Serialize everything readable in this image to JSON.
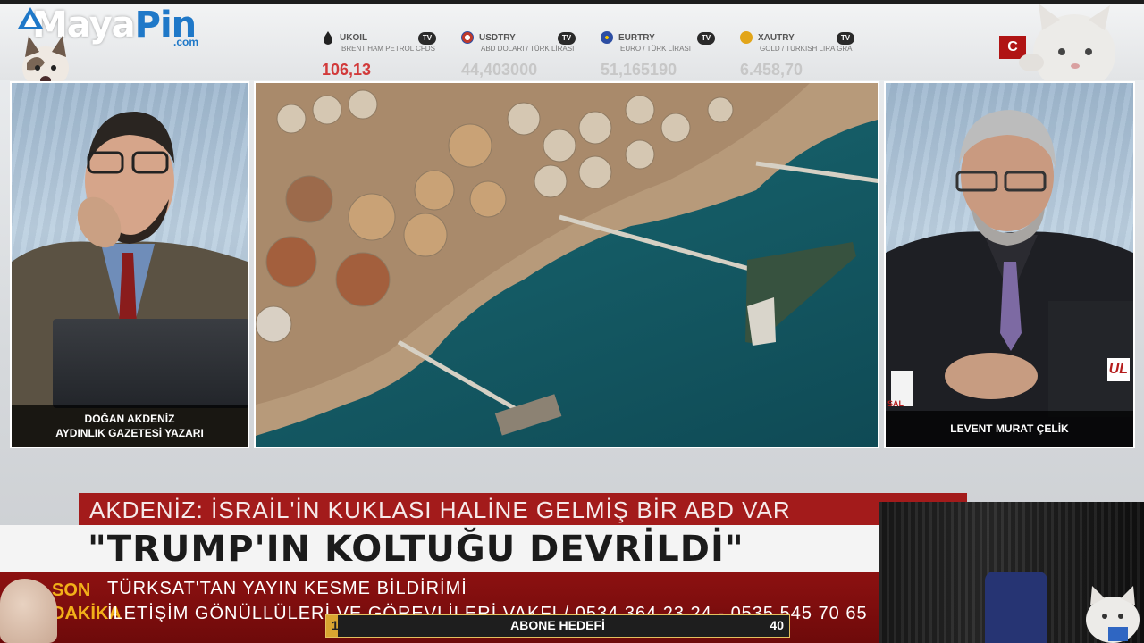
{
  "logo": {
    "maya": "Maya",
    "pin": "Pin",
    "com": ".com"
  },
  "tickers": [
    {
      "code": "UKOIL",
      "desc": "BRENT HAM PETROL CFDS",
      "value": "106,13",
      "color": "#222222",
      "value_color": "#d23a3a"
    },
    {
      "code": "USDTRY",
      "desc": "ABD DOLARI / TÜRK LİRASI",
      "value": "44,403000",
      "color": "#c0392b",
      "value_color": "#c7c7c7"
    },
    {
      "code": "EURTRY",
      "desc": "EURO / TÜRK LİRASI",
      "value": "51,165190",
      "color": "#2d4ea3",
      "value_color": "#c7c7c7"
    },
    {
      "code": "XAUTRY",
      "desc": "GOLD / TURKISH LIRA GRA",
      "value": "6.458,70",
      "color": "#e2a519",
      "value_color": "#c7c7c7"
    }
  ],
  "tv_badge": "TV",
  "red_tag": "C",
  "left_panel": {
    "name": "DOĞAN AKDENİZ",
    "title": "AYDINLIK GAZETESİ YAZARI"
  },
  "right_panel": {
    "name": "LEVENT MURAT ÇELİK",
    "screen_text": "UL",
    "cup_text": "SAL"
  },
  "headline": {
    "subtitle": "AKDENİZ: İSRAİL'İN KUKLASI HALİNE GELMİŞ BİR ABD VAR",
    "title": "\"TRUMP'IN KOLTUĞU DEVRİLDİ\""
  },
  "ticker_bottom": {
    "side": "SON\nDAKİKA",
    "line1": "TÜRKSAT'TAN YAYIN KESME BİLDİRİMİ",
    "line2": "İLETİŞİM GÖNÜLLÜLERİ VE GÖREVLİLERİ VAKFI / 0534 364 23 24 - 0535 545 70 65"
  },
  "subscribe_goal": {
    "label": "ABONE HEDEFİ",
    "current": "1",
    "target": "40",
    "progress_fraction": 0.025
  },
  "colors": {
    "accent_red": "#a31b1b",
    "brand_blue": "#1f78c8",
    "gold": "#d9a531"
  }
}
